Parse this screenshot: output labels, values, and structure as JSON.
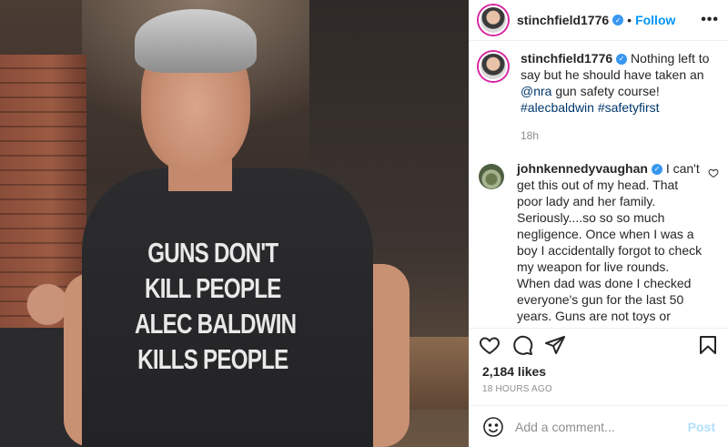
{
  "photo": {
    "shirt_text": [
      "GUNS DON'T",
      "KILL PEOPLE",
      "ALEC BALDWIN",
      "KILLS PEOPLE"
    ]
  },
  "header": {
    "username": "stinchfield1776",
    "separator": "•",
    "follow_label": "Follow",
    "more_label": "•••"
  },
  "caption": {
    "username": "stinchfield1776",
    "text": "Nothing left to say but he should have taken an",
    "mention": "@nra",
    "text2": "gun safety course!",
    "hashtag1": "#alecbaldwin",
    "hashtag2": "#safetyfirst",
    "age": "18h"
  },
  "comment": {
    "username": "johnkennedyvaughan",
    "text": "I can't get this out of my head. That poor lady and her family. Seriously....so so so much negligence. Once when I was a boy I accidentally forgot to check my weapon for live rounds. When dad was done I checked everyone's gun for the last 50 years. Guns are not toys or props. They have no soul. This was"
  },
  "stats": {
    "likes": "2,184 likes",
    "time": "18 HOURS AGO"
  },
  "composer": {
    "placeholder": "Add a comment...",
    "post_label": "Post"
  },
  "colors": {
    "link": "#00376b",
    "follow": "#0095f6",
    "verified": "#3897f0",
    "post_disabled": "#b2dffc"
  }
}
